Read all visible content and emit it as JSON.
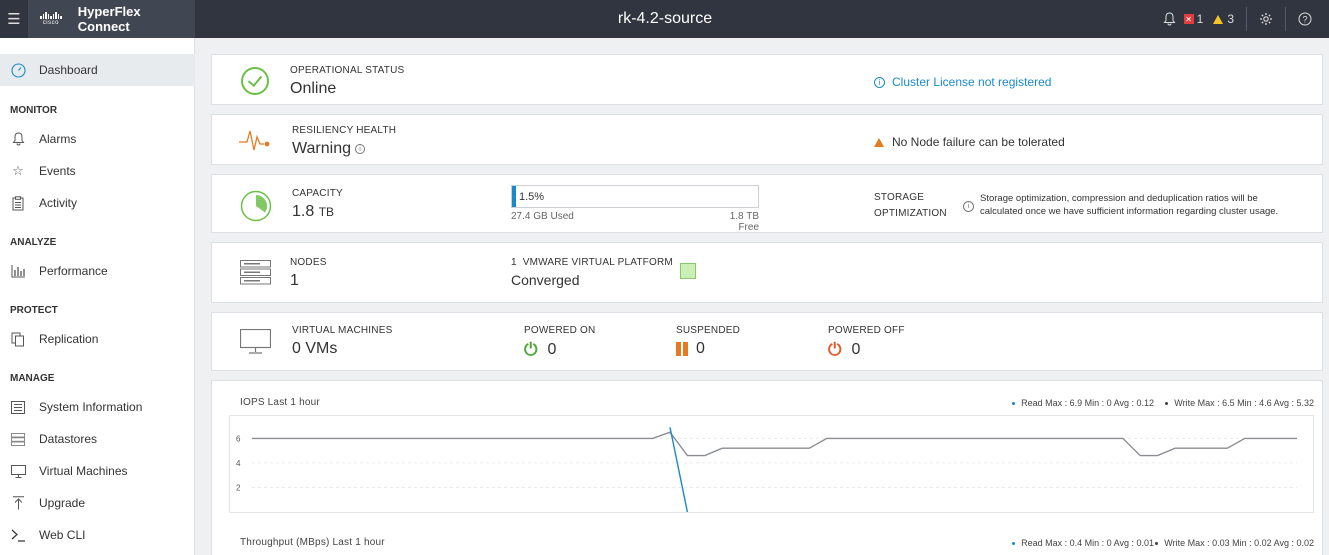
{
  "topbar": {
    "brand_word": "cisco",
    "brand_name": "HyperFlex Connect",
    "cluster_name": "rk-4.2-source",
    "critical_count": "1",
    "warning_count": "3"
  },
  "sidebar": {
    "dashboard": "Dashboard",
    "sections": {
      "monitor": "MONITOR",
      "analyze": "ANALYZE",
      "protect": "PROTECT",
      "manage": "MANAGE"
    },
    "items": {
      "alarms": "Alarms",
      "events": "Events",
      "activity": "Activity",
      "performance": "Performance",
      "replication": "Replication",
      "system_information": "System Information",
      "datastores": "Datastores",
      "virtual_machines": "Virtual Machines",
      "upgrade": "Upgrade",
      "web_cli": "Web CLI"
    }
  },
  "operational": {
    "label": "OPERATIONAL STATUS",
    "value": "Online",
    "license_msg": "Cluster License not registered"
  },
  "resiliency": {
    "label": "RESILIENCY HEALTH",
    "value": "Warning",
    "message": "No Node failure can be tolerated"
  },
  "capacity": {
    "label": "CAPACITY",
    "value": "1.8",
    "unit": "TB",
    "used_percent": 1.5,
    "used_percent_label": "1.5%",
    "used": "27.4 GB Used",
    "free": "1.8 TB Free",
    "storage_opt_label_1": "STORAGE",
    "storage_opt_label_2": "OPTIMIZATION",
    "storage_opt_msg_1": "Storage optimization, compression and deduplication ratios will be",
    "storage_opt_msg_2": "calculated once we have sufficient information regarding cluster usage."
  },
  "nodes": {
    "label": "NODES",
    "value": "1",
    "platform_label": "1  VMWARE VIRTUAL PLATFORM",
    "platform_value": "Converged"
  },
  "vms": {
    "label": "VIRTUAL MACHINES",
    "value": "0 VMs",
    "powered_on_label": "POWERED ON",
    "powered_on": "0",
    "suspended_label": "SUSPENDED",
    "suspended": "0",
    "powered_off_label": "POWERED OFF",
    "powered_off": "0"
  },
  "colors": {
    "accent": "#1a8ac7",
    "ok": "#6cc04a",
    "warning": "#e47b22",
    "critical": "#e23c3c",
    "read_series": "#1a8ac7",
    "write_series": "#8a8d91"
  },
  "iops_chart": {
    "title": "IOPS Last 1 hour",
    "read_legend": "Read Max : 6.9 Min : 0 Avg : 0.12",
    "write_legend": "Write Max : 6.5 Min : 4.6 Avg : 5.32"
  },
  "throughput_chart": {
    "title": "Throughput (MBps) Last 1 hour",
    "read_legend": "Read Max : 0.4 Min : 0 Avg : 0.01",
    "write_legend": "Write Max : 0.03 Min : 0.02 Avg : 0.02"
  },
  "chart_data": {
    "type": "line",
    "x": [
      0,
      1,
      2,
      3,
      4,
      5,
      6,
      7,
      8,
      9,
      10,
      11,
      12,
      13,
      14,
      15,
      16,
      17,
      18,
      19,
      20,
      21,
      22,
      23,
      24,
      25,
      26,
      27,
      28,
      29,
      30,
      31,
      32,
      33,
      34,
      35,
      36,
      37,
      38,
      39,
      40,
      41,
      42,
      43,
      44,
      45,
      46,
      47,
      48,
      49,
      50,
      51,
      52,
      53,
      54,
      55,
      56,
      57,
      58,
      59,
      60
    ],
    "y_ticks": [
      2,
      4,
      6
    ],
    "ylim": [
      0,
      7.5
    ],
    "series": [
      {
        "name": "Write",
        "values": [
          6,
          6,
          6,
          6,
          6,
          6,
          6,
          6,
          6,
          6,
          6,
          6,
          6,
          6,
          6,
          6,
          6,
          6,
          6,
          6,
          6,
          6,
          6,
          6,
          6.5,
          4.6,
          4.6,
          5.2,
          5.2,
          5.2,
          5.2,
          5.2,
          5.2,
          6,
          6,
          6,
          6,
          6,
          6,
          6,
          6,
          6,
          6,
          6,
          6,
          6,
          6,
          6,
          6,
          6,
          6,
          4.6,
          4.6,
          5.2,
          5.2,
          5.2,
          5.2,
          6,
          6,
          6,
          6
        ]
      },
      {
        "name": "Read",
        "values": [
          0,
          0,
          0,
          0,
          0,
          0,
          0,
          0,
          0,
          0,
          0,
          0,
          0,
          0,
          0,
          0,
          0,
          0,
          0,
          0,
          0,
          0,
          0,
          0,
          6.9,
          0,
          0,
          0,
          0,
          0,
          0,
          0,
          0,
          0,
          0,
          0,
          0,
          0,
          0,
          0,
          0,
          0,
          0,
          0,
          0,
          0,
          0,
          0,
          0,
          0,
          0,
          0,
          0,
          0,
          0,
          0,
          0,
          0,
          0,
          0,
          0
        ]
      }
    ]
  }
}
